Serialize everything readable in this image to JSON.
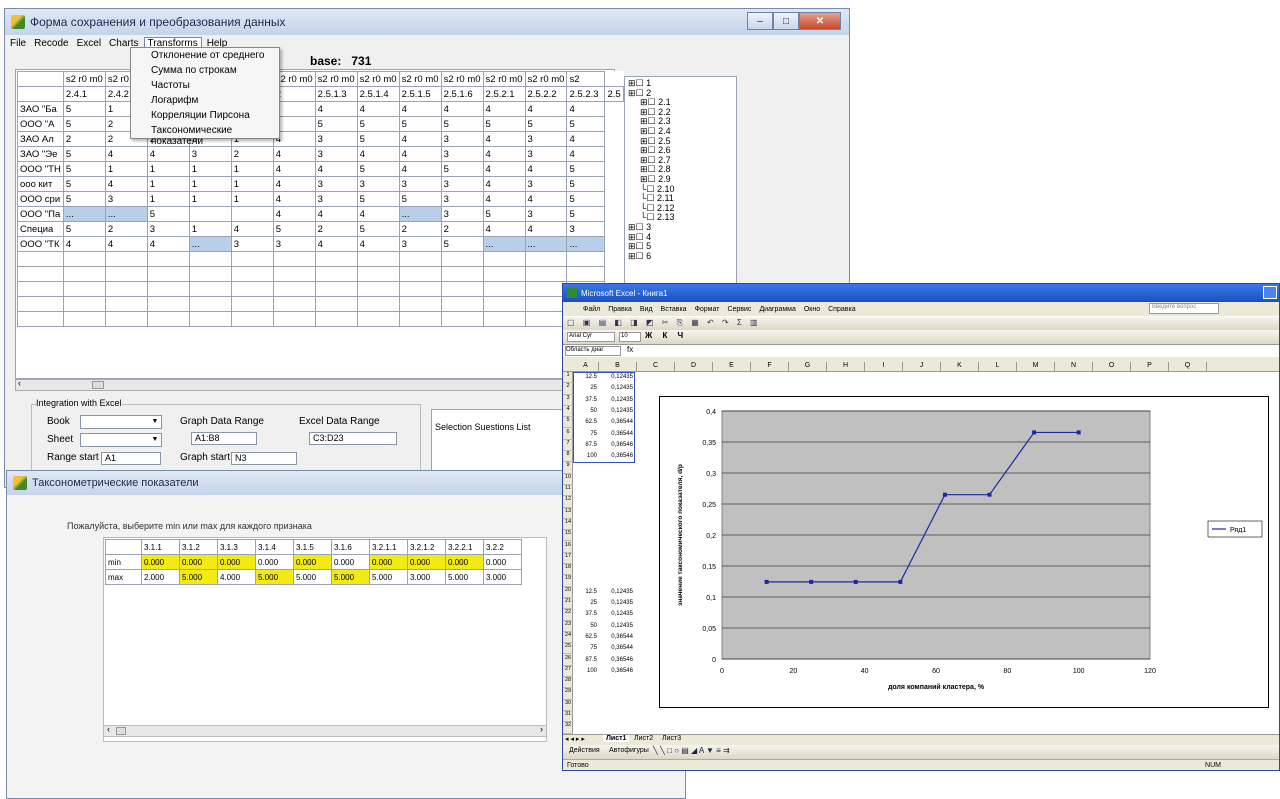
{
  "main_window": {
    "title": "Форма сохранения и преобразования данных",
    "menu": [
      "File",
      "Recode",
      "Excel",
      "Charts",
      "Transforms",
      "Help"
    ],
    "transforms_menu": [
      "Отклонение от среднего",
      "Сумма по строкам",
      "Частоты",
      "Логарифм",
      "Корреляции Пирсона",
      "Таксономические показатели"
    ],
    "base_label": "base:",
    "base_value": "731",
    "col_codes": [
      "s2 r0 m0",
      "s2 r0 m0",
      "s2 r0 m0",
      "s2 r0 m0",
      "s2 r0 m0",
      "s2 r0 m0",
      "s2 r0 m0",
      "s2 r0 m0",
      "s2 r0 m0",
      "s2 r0 m0",
      "s2 r0 m0",
      "s2 r0 m0",
      "s2"
    ],
    "col_ids": [
      "2.4.1",
      "2.4.2",
      "",
      "",
      "",
      "2",
      "2.5.1.3",
      "2.5.1.4",
      "2.5.1.5",
      "2.5.1.6",
      "2.5.2.1",
      "2.5.2.2",
      "2.5.2.3",
      "2.5"
    ],
    "rows": [
      {
        "name": "ЗАО \"Ба",
        "vals": [
          "5",
          "1",
          "",
          "",
          "",
          "",
          "4",
          "4",
          "4",
          "4",
          "4",
          "4",
          "4"
        ]
      },
      {
        "name": "ООО \"А",
        "vals": [
          "5",
          "2",
          "",
          "",
          "",
          "",
          "5",
          "5",
          "5",
          "5",
          "5",
          "5",
          "5"
        ]
      },
      {
        "name": "ЗАО Ал",
        "vals": [
          "2",
          "2",
          "2",
          "5",
          "1",
          "4",
          "3",
          "5",
          "4",
          "3",
          "4",
          "3",
          "4"
        ]
      },
      {
        "name": "ЗАО \"Эе",
        "vals": [
          "5",
          "4",
          "4",
          "3",
          "2",
          "4",
          "3",
          "4",
          "4",
          "3",
          "4",
          "3",
          "4"
        ]
      },
      {
        "name": "ООО \"ТН",
        "vals": [
          "5",
          "1",
          "1",
          "1",
          "1",
          "4",
          "4",
          "5",
          "4",
          "5",
          "4",
          "4",
          "5"
        ]
      },
      {
        "name": "ооо кит",
        "vals": [
          "5",
          "4",
          "1",
          "1",
          "1",
          "4",
          "3",
          "3",
          "3",
          "3",
          "4",
          "3",
          "5"
        ]
      },
      {
        "name": "ООО сри",
        "vals": [
          "5",
          "3",
          "1",
          "1",
          "1",
          "4",
          "3",
          "5",
          "5",
          "3",
          "4",
          "4",
          "5"
        ]
      },
      {
        "name": "ООО \"Па",
        "vals": [
          "...",
          "...",
          "5",
          "",
          "",
          "4",
          "4",
          "4",
          "...",
          "3",
          "5",
          "3",
          "5"
        ]
      },
      {
        "name": "Специа",
        "vals": [
          "5",
          "2",
          "3",
          "1",
          "4",
          "5",
          "2",
          "5",
          "2",
          "2",
          "4",
          "4",
          "3"
        ]
      },
      {
        "name": "ООО \"ТК",
        "vals": [
          "4",
          "4",
          "4",
          "...",
          "3",
          "3",
          "4",
          "4",
          "3",
          "5",
          "...",
          "...",
          "..."
        ]
      }
    ],
    "tree": [
      "1",
      "2",
      "2.1",
      "2.2",
      "2.3",
      "2.4",
      "2.5",
      "2.6",
      "2.7",
      "2.8",
      "2.9",
      "2.10",
      "2.11",
      "2.12",
      "2.13",
      "3",
      "4",
      "5",
      "6"
    ],
    "integration": {
      "title": "Integration with Excel",
      "book": "Book",
      "sheet": "Sheet",
      "range_start": "Range start",
      "range_start_val": "A1",
      "graph_range": "Graph Data Range",
      "graph_range_val": "A1:B8",
      "excel_range": "Excel Data Range",
      "excel_range_val": "C3:D23",
      "graph_start": "Graph start",
      "graph_start_val": "N3",
      "selection": "Selection Suestions List"
    }
  },
  "tax_window": {
    "title": "Таксонометрические показатели",
    "prompt": "Пожалуйста, выберите min или max для каждого признака",
    "headers": [
      "3.1.1",
      "3.1.2",
      "3.1.3",
      "3.1.4",
      "3.1.5",
      "3.1.6",
      "3.2.1.1",
      "3.2.1.2",
      "3.2.2.1",
      "3.2.2"
    ],
    "min_label": "min",
    "max_label": "max",
    "min": [
      "0.000",
      "0.000",
      "0.000",
      "0.000",
      "0.000",
      "0.000",
      "0.000",
      "0.000",
      "0.000",
      "0.000"
    ],
    "max": [
      "2.000",
      "5.000",
      "4.000",
      "5.000",
      "5.000",
      "5.000",
      "5.000",
      "3.000",
      "5.000",
      "3.000"
    ]
  },
  "excel": {
    "title": "Microsoft Excel - Книга1",
    "menu": [
      "Файл",
      "Правка",
      "Вид",
      "Вставка",
      "Формат",
      "Сервис",
      "Диаграмма",
      "Окно",
      "Справка"
    ],
    "help_placeholder": "Введите вопрос",
    "font": "Arial Cyr",
    "size": "10",
    "namebox": "Область диаг",
    "cols": [
      "A",
      "B",
      "C",
      "D",
      "E",
      "F",
      "G",
      "H",
      "I",
      "J",
      "K",
      "L",
      "M",
      "N",
      "O",
      "P",
      "Q"
    ],
    "data_top": [
      [
        "12.5",
        "0,12435"
      ],
      [
        "25",
        "0,12435"
      ],
      [
        "37.5",
        "0,12435"
      ],
      [
        "50",
        "0,12435"
      ],
      [
        "62.5",
        "0,36544"
      ],
      [
        "75",
        "0,36544"
      ],
      [
        "87.5",
        "0,36546"
      ],
      [
        "100",
        "0,36546"
      ]
    ],
    "data_bottom": [
      [
        "12.5",
        "0,12435"
      ],
      [
        "25",
        "0,12435"
      ],
      [
        "37.5",
        "0,12435"
      ],
      [
        "50",
        "0,12435"
      ],
      [
        "62.5",
        "0,36544"
      ],
      [
        "75",
        "0,36544"
      ],
      [
        "87.5",
        "0,36546"
      ],
      [
        "100",
        "0,36546"
      ]
    ],
    "sheets": [
      "Лист1",
      "Лист2",
      "Лист3"
    ],
    "drawing": "Действия",
    "autoshapes": "Автофигуры",
    "status": "Готово",
    "status_right": "NUM"
  },
  "chart_data": {
    "type": "line",
    "x": [
      12.5,
      25,
      37.5,
      50,
      62.5,
      75,
      87.5,
      100
    ],
    "series": [
      {
        "name": "Ряд1",
        "values": [
          0.12435,
          0.12435,
          0.12435,
          0.12435,
          0.265,
          0.265,
          0.36544,
          0.36546
        ]
      }
    ],
    "xlabel": "доля компаний кластера, %",
    "ylabel": "значение таксономического показателя, d/p",
    "xlim": [
      0,
      120
    ],
    "ylim": [
      0,
      0.4
    ],
    "xticks": [
      "0",
      "20",
      "40",
      "60",
      "80",
      "100",
      "120"
    ],
    "yticks": [
      "0",
      "0,05",
      "0,1",
      "0,15",
      "0,2",
      "0,25",
      "0,3",
      "0,35",
      "0,4"
    ],
    "grid": true,
    "legend": "right"
  }
}
